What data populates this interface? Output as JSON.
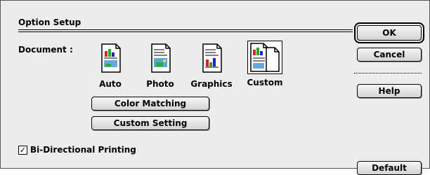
{
  "dialog": {
    "section_title": "Option Setup",
    "document_label": "Document :",
    "document_options": [
      {
        "label": "Auto",
        "icon": "auto-document-icon"
      },
      {
        "label": "Photo",
        "icon": "photo-document-icon"
      },
      {
        "label": "Graphics",
        "icon": "graphics-document-icon"
      },
      {
        "label": "Custom",
        "icon": "custom-document-icon",
        "selected": true
      }
    ],
    "buttons": {
      "ok": "OK",
      "cancel": "Cancel",
      "help": "Help",
      "default": "Default",
      "color_matching": "Color Matching",
      "custom_setting": "Custom Setting"
    },
    "bidirectional": {
      "label": "Bi-Directional Printing",
      "checked": true,
      "mark": "✓"
    }
  }
}
